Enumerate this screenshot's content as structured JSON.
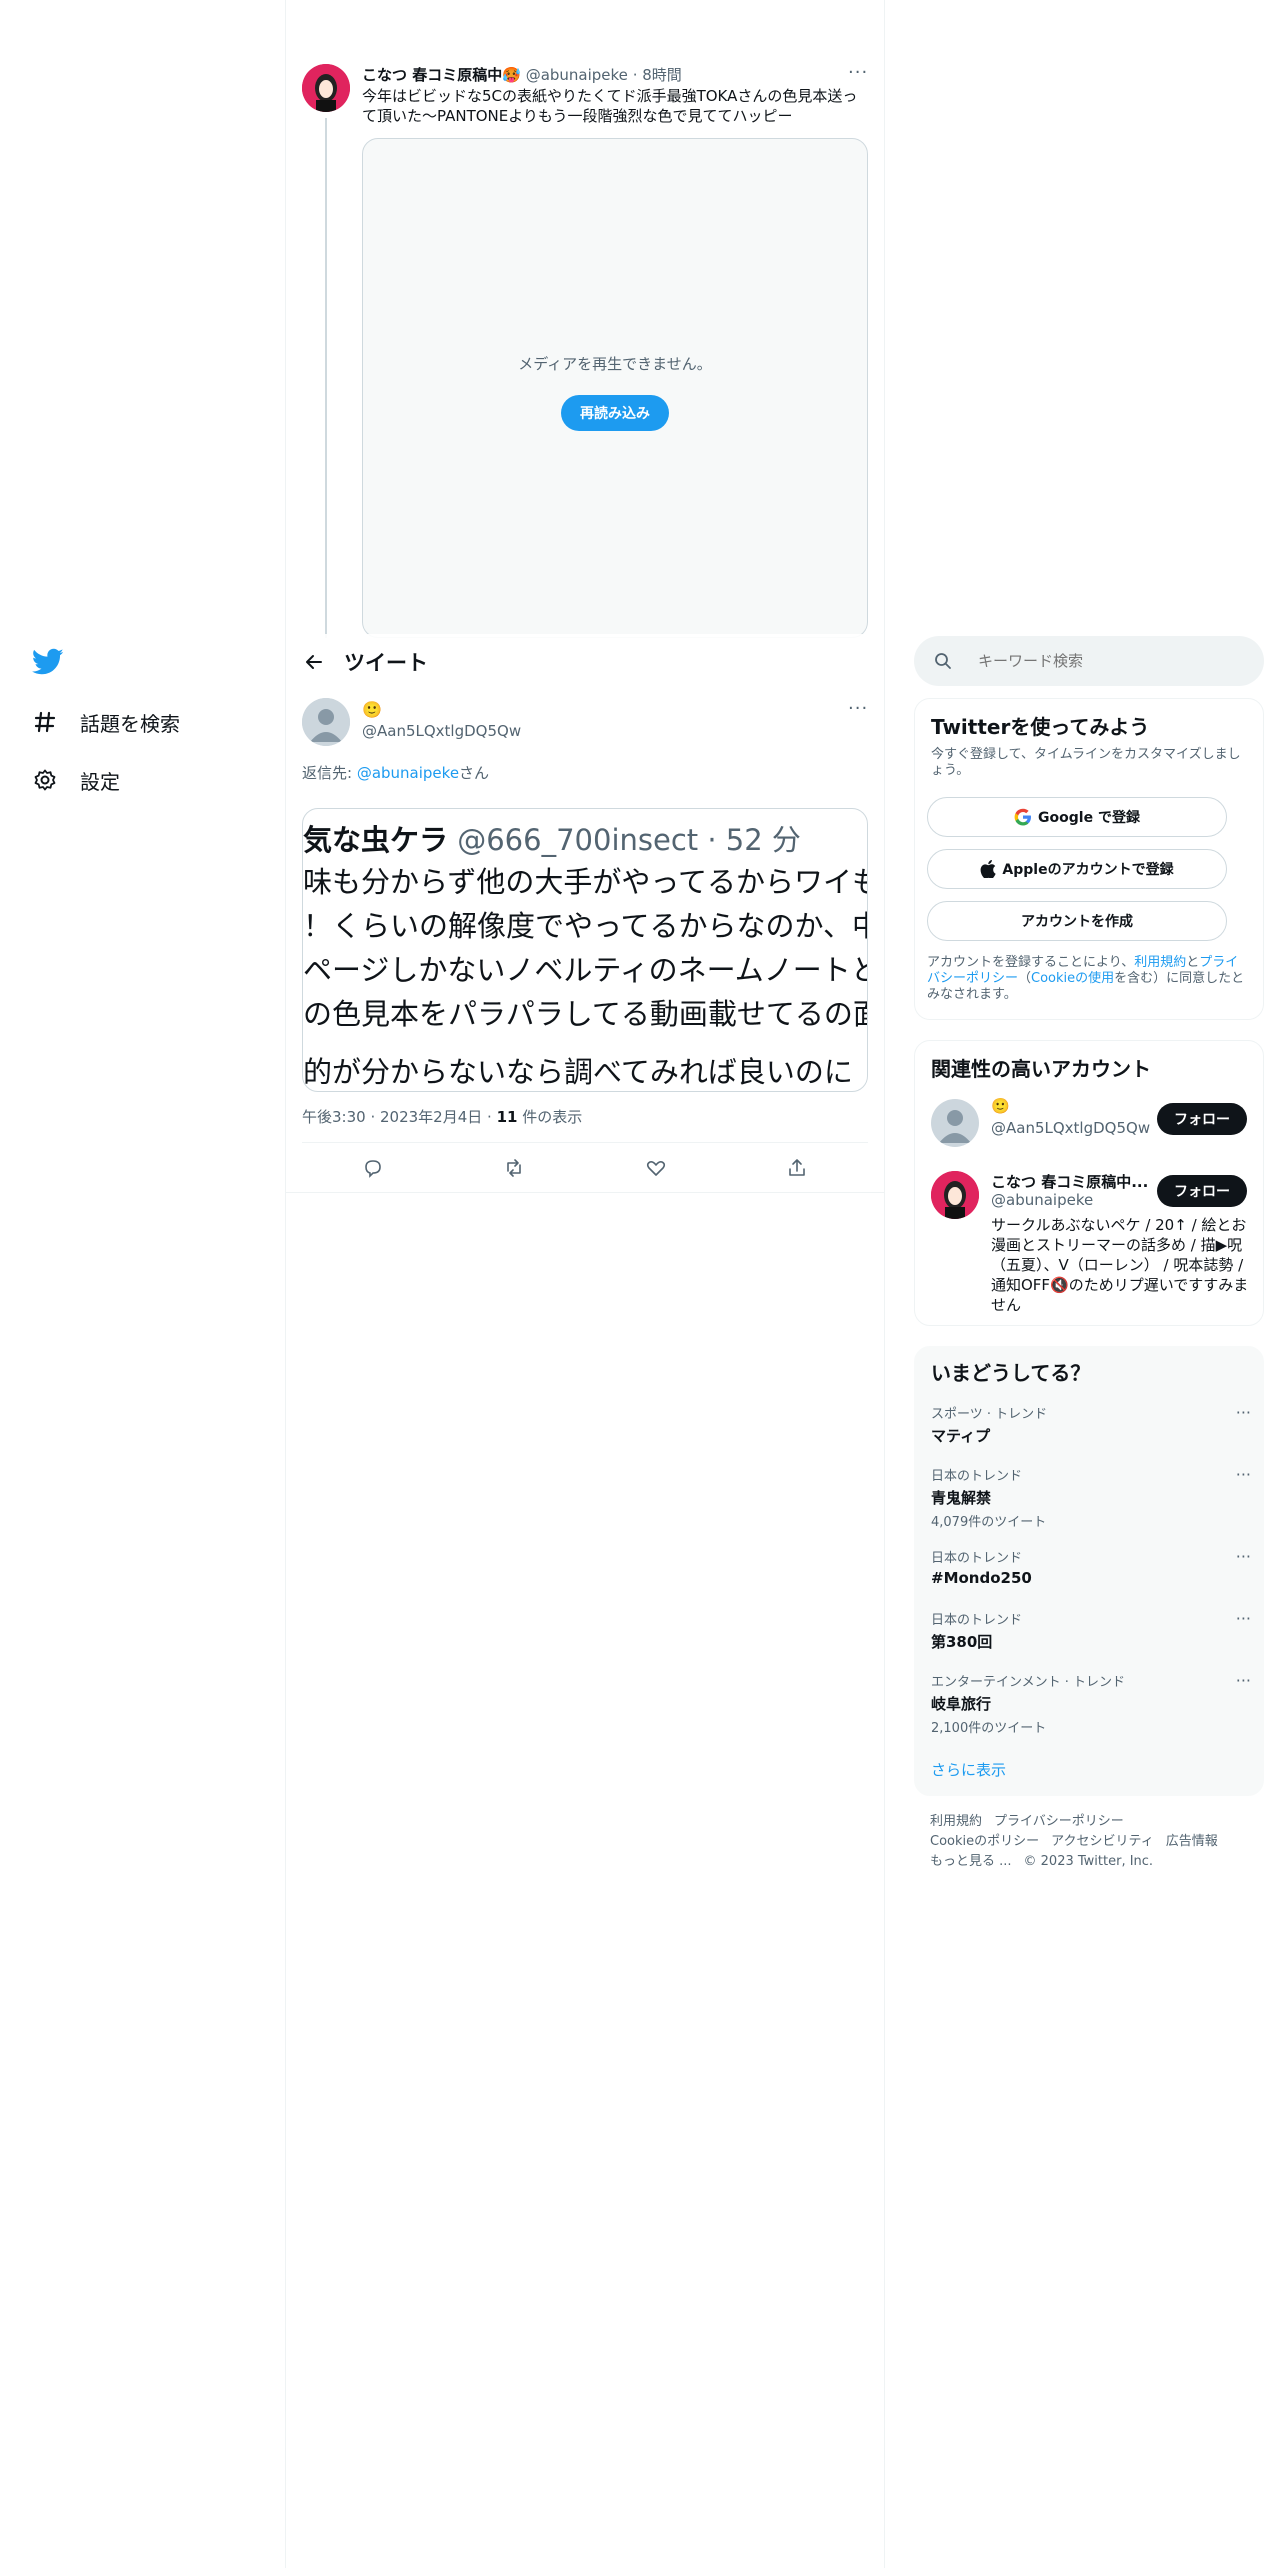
{
  "nav": {
    "items": [
      {
        "label": "話題を検索",
        "icon": "hashtag-icon"
      },
      {
        "label": "設定",
        "icon": "gear-icon"
      }
    ]
  },
  "parent_tweet": {
    "name": "こなつ 春コミ原稿中🥵",
    "handle": "@abunaipeke",
    "dot": "·",
    "time": "8時間",
    "more": "···",
    "text": "今年はビビッドな5Cの表紙やりたくてド派手最強TOKAさんの色見本送って頂いた〜PANTONEよりもう一段階強烈な色で見ててハッピー",
    "media_error": "メディアを再生できません。",
    "reload_label": "再読み込み"
  },
  "header": {
    "title": "ツイート"
  },
  "main_tweet": {
    "emoji_name": "🙂",
    "handle": "@Aan5LQxtlgDQ5Qw",
    "more": "···",
    "reply_prefix": "返信先: ",
    "reply_handle": "@abunaipeke",
    "reply_suffix": "さん",
    "embed": {
      "name": "気な虫ケラ",
      "handle": "@666_700insect",
      "time": "· 52 分",
      "lines": [
        "味も分からず他の大手がやってるからワイも",
        "！くらいの解像度でやってるからなのか、中",
        "ページしかないノベルティのネームノートと",
        "の色見本をパラパラしてる動画載せてるの面",
        "",
        "的が分からないなら調べてみれば良いのに"
      ]
    },
    "time": "午後3:30",
    "date": "2023年2月4日",
    "views": "11",
    "views_suffix": " 件の表示"
  },
  "search": {
    "placeholder": "キーワード検索"
  },
  "signup": {
    "title": "Twitterを使ってみよう",
    "desc": "今すぐ登録して、タイムラインをカスタマイズしましょう。",
    "google": "Google で登録",
    "apple": "Appleのアカウントで登録",
    "create": "アカウントを作成",
    "terms_1": "アカウントを登録することにより、",
    "terms_link1": "利用規約",
    "terms_2": "と",
    "terms_link2": "プライバシーポリシー",
    "terms_3": "（",
    "terms_link3": "Cookieの使用",
    "terms_4": "を含む）に同意したとみなされます。"
  },
  "related": {
    "title": "関連性の高いアカウント",
    "accounts": [
      {
        "name": "🙂",
        "handle": "@Aan5LQxtlgDQ5Qw",
        "follow": "フォロー"
      },
      {
        "name": "こなつ 春コミ原稿中...",
        "handle": "@abunaipeke",
        "follow": "フォロー",
        "bio": "サークルあぶないペケ / 20↑ / 絵とお漫画とストリーマーの話多め / 描▶呪（五夏）、V（ローレン） / 呪本誌勢 / 通知OFF🔇のためリプ遅いですすみません"
      }
    ]
  },
  "trends": {
    "title": "いまどうしてる？",
    "items": [
      {
        "category": "スポーツ · トレンド",
        "name": "マティプ",
        "count": ""
      },
      {
        "category": "日本のトレンド",
        "name": "青鬼解禁",
        "count": "4,079件のツイート"
      },
      {
        "category": "日本のトレンド",
        "name": "#Mondo250",
        "count": ""
      },
      {
        "category": "日本のトレンド",
        "name": "第380回",
        "count": ""
      },
      {
        "category": "エンターテインメント · トレンド",
        "name": "岐阜旅行",
        "count": "2,100件のツイート"
      }
    ],
    "show_more": "さらに表示",
    "more": "···"
  },
  "footer": {
    "links": [
      "利用規約",
      "プライバシーポリシー",
      "Cookieのポリシー",
      "アクセシビリティ",
      "広告情報",
      "もっと見る ..."
    ],
    "copyright": "© 2023 Twitter, Inc."
  },
  "colors": {
    "accent": "#1d9bf0",
    "text": "#0f1419",
    "muted": "#536471",
    "border": "#eff3f4"
  }
}
